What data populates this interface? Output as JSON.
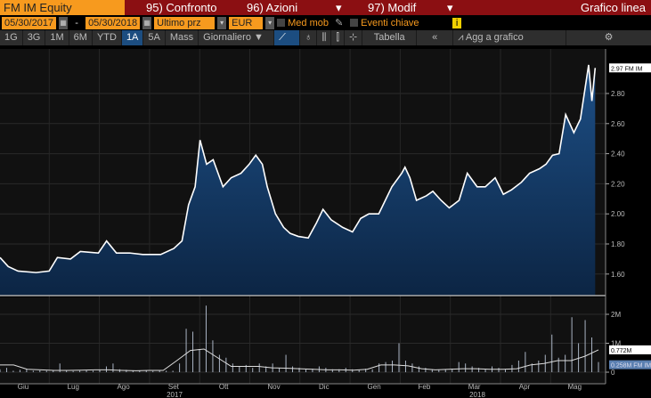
{
  "header": {
    "ticker": "FM IM Equity",
    "confronto": "95) Confronto",
    "azioni": "96) Azioni",
    "modif": "97) Modif",
    "chart_type": "Grafico linea"
  },
  "controls": {
    "start_date": "05/30/2017",
    "sep": "-",
    "end_date": "05/30/2018",
    "field": "Ultimo prz",
    "currency": "EUR",
    "moving_avg": "Med mob",
    "events": "Eventi chiave",
    "info": "i"
  },
  "toolbar": {
    "periods": [
      "1G",
      "3G",
      "1M",
      "6M",
      "YTD",
      "1A",
      "5A",
      "Mass"
    ],
    "active_period": "1A",
    "frequency": "Giornaliero ▼",
    "table": "Tabella",
    "collapse": "«",
    "add_chart": "Agg a grafico"
  },
  "colors": {
    "accent": "#f79a1e",
    "header_bg": "#8b0f12",
    "area": "#1a4a7c"
  },
  "chart_data": {
    "type": "area",
    "price": {
      "yticks": [
        1.6,
        1.8,
        2.0,
        2.2,
        2.4,
        2.6,
        2.8
      ],
      "ytick_labels": [
        "1.60",
        "1.80",
        "2.00",
        "2.20",
        "2.40",
        "2.60",
        "2.80"
      ],
      "ylim": [
        1.45,
        3.05
      ],
      "last_label": "2.97 FM IM",
      "points": [
        [
          0,
          1.71
        ],
        [
          5,
          1.65
        ],
        [
          11,
          1.62
        ],
        [
          22,
          1.61
        ],
        [
          30,
          1.62
        ],
        [
          35,
          1.71
        ],
        [
          43,
          1.7
        ],
        [
          49,
          1.75
        ],
        [
          60,
          1.74
        ],
        [
          65,
          1.82
        ],
        [
          71,
          1.74
        ],
        [
          79,
          1.74
        ],
        [
          87,
          1.73
        ],
        [
          98,
          1.73
        ],
        [
          106,
          1.77
        ],
        [
          111,
          1.82
        ],
        [
          115,
          2.06
        ],
        [
          119,
          2.18
        ],
        [
          122,
          2.49
        ],
        [
          126,
          2.33
        ],
        [
          130,
          2.36
        ],
        [
          136,
          2.18
        ],
        [
          141,
          2.24
        ],
        [
          147,
          2.27
        ],
        [
          152,
          2.33
        ],
        [
          156,
          2.39
        ],
        [
          160,
          2.33
        ],
        [
          163,
          2.18
        ],
        [
          168,
          2.0
        ],
        [
          173,
          1.91
        ],
        [
          177,
          1.87
        ],
        [
          182,
          1.85
        ],
        [
          188,
          1.84
        ],
        [
          193,
          1.94
        ],
        [
          197,
          2.03
        ],
        [
          202,
          1.96
        ],
        [
          209,
          1.91
        ],
        [
          215,
          1.88
        ],
        [
          220,
          1.97
        ],
        [
          225,
          2.0
        ],
        [
          231,
          2.0
        ],
        [
          235,
          2.09
        ],
        [
          239,
          2.18
        ],
        [
          245,
          2.27
        ],
        [
          247,
          2.31
        ],
        [
          250,
          2.24
        ],
        [
          254,
          2.09
        ],
        [
          260,
          2.12
        ],
        [
          264,
          2.15
        ],
        [
          269,
          2.09
        ],
        [
          274,
          2.04
        ],
        [
          280,
          2.09
        ],
        [
          285,
          2.27
        ],
        [
          291,
          2.18
        ],
        [
          296,
          2.18
        ],
        [
          302,
          2.24
        ],
        [
          307,
          2.13
        ],
        [
          312,
          2.16
        ],
        [
          318,
          2.21
        ],
        [
          323,
          2.27
        ],
        [
          329,
          2.3
        ],
        [
          333,
          2.33
        ],
        [
          337,
          2.39
        ],
        [
          341,
          2.4
        ],
        [
          345,
          2.66
        ],
        [
          350,
          2.54
        ],
        [
          354,
          2.63
        ],
        [
          359,
          2.99
        ],
        [
          361,
          2.75
        ],
        [
          363,
          2.97
        ]
      ]
    },
    "volume": {
      "ytick_labels": [
        "0",
        "1M",
        "2M"
      ],
      "ylim": [
        0,
        2.5
      ],
      "last_avg_label": "0.772M",
      "last_label": "0.258M FM IM",
      "bars": [
        0.1,
        0.15,
        0.05,
        0.08,
        0.1,
        0.05,
        0.06,
        0.05,
        0.07,
        0.3,
        0.05,
        0.04,
        0.05,
        0.06,
        0.05,
        0.08,
        0.2,
        0.3,
        0.1,
        0.08,
        0.06,
        0.05,
        0.05,
        0.04,
        0.06,
        0.05,
        0.05,
        0.3,
        1.5,
        1.4,
        0.8,
        2.3,
        1.1,
        0.6,
        0.5,
        0.3,
        0.2,
        0.25,
        0.15,
        0.3,
        0.2,
        0.3,
        0.15,
        0.6,
        0.2,
        0.15,
        0.1,
        0.12,
        0.2,
        0.15,
        0.1,
        0.1,
        0.15,
        0.1,
        0.08,
        0.12,
        0.1,
        0.3,
        0.35,
        0.4,
        1.0,
        0.4,
        0.3,
        0.2,
        0.15,
        0.1,
        0.08,
        0.1,
        0.12,
        0.35,
        0.3,
        0.2,
        0.15,
        0.1,
        0.2,
        0.15,
        0.1,
        0.25,
        0.4,
        0.7,
        0.3,
        0.4,
        0.6,
        1.3,
        0.5,
        0.6,
        1.9,
        1.0,
        1.8,
        1.2,
        0.35
      ],
      "avg": [
        0.25,
        0.25,
        0.1,
        0.08,
        0.06,
        0.06,
        0.07,
        0.08,
        0.08,
        0.06,
        0.05,
        0.06,
        0.06,
        0.4,
        0.75,
        0.8,
        0.5,
        0.2,
        0.2,
        0.2,
        0.15,
        0.14,
        0.12,
        0.1,
        0.08,
        0.08,
        0.07,
        0.1,
        0.25,
        0.25,
        0.22,
        0.12,
        0.08,
        0.1,
        0.12,
        0.12,
        0.1,
        0.1,
        0.12,
        0.25,
        0.3,
        0.4,
        0.4,
        0.55,
        0.77
      ]
    },
    "xticks": [
      "Giu",
      "Lug",
      "Ago",
      "Set",
      "Ott",
      "Nov",
      "Dic",
      "Gen",
      "Feb",
      "Mar",
      "Apr",
      "Mag"
    ],
    "years": [
      "2017",
      "2018"
    ]
  }
}
